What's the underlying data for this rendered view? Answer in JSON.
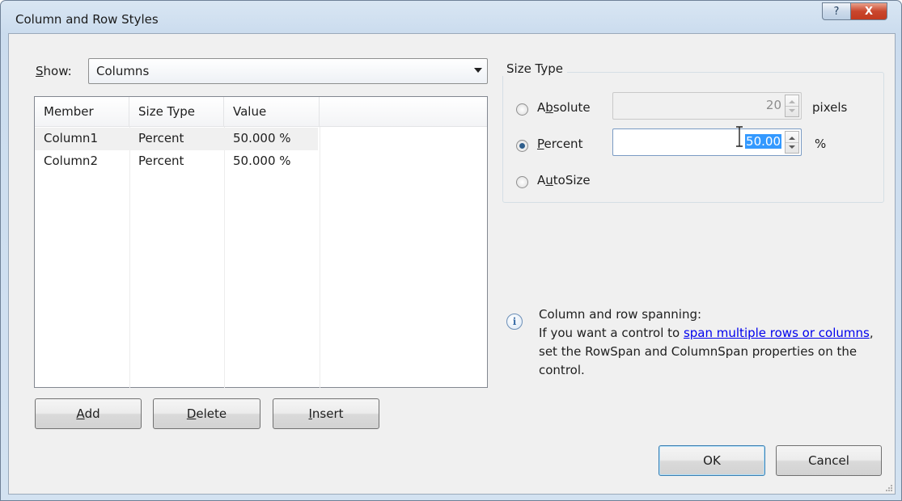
{
  "window": {
    "title": "Column and Row Styles",
    "help_glyph": "?",
    "close_glyph": "X"
  },
  "show": {
    "label_prefix": "S",
    "label_rest": "how:",
    "selected": "Columns"
  },
  "list": {
    "columns": [
      "Member",
      "Size Type",
      "Value"
    ],
    "rows": [
      {
        "member": "Column1",
        "size_type": "Percent",
        "value": "50.000 %"
      },
      {
        "member": "Column2",
        "size_type": "Percent",
        "value": "50.000 %"
      }
    ]
  },
  "buttons": {
    "add": {
      "mnemonic": "A",
      "rest": "dd"
    },
    "delete": {
      "mnemonic": "D",
      "rest": "elete"
    },
    "insert": {
      "mnemonic": "I",
      "rest": "nsert"
    },
    "ok": "OK",
    "cancel": "Cancel"
  },
  "size_type": {
    "title": "Size Type",
    "absolute": {
      "pre": "A",
      "mnemonic": "b",
      "rest": "solute",
      "value": "20",
      "unit": "pixels",
      "checked": false,
      "enabled": false
    },
    "percent": {
      "pre": "",
      "mnemonic": "P",
      "rest": "ercent",
      "value": "50.00",
      "unit": "%",
      "checked": true,
      "enabled": true
    },
    "autosize": {
      "pre": "A",
      "mnemonic": "u",
      "rest": "toSize",
      "checked": false
    }
  },
  "info": {
    "heading": "Column and row spanning:",
    "line_pre": "If you want a control to ",
    "link_text": "span multiple rows or columns",
    "line_post": ", set the RowSpan and ColumnSpan properties on the control.",
    "icon": "info-icon"
  },
  "colors": {
    "title_bar": "#cbdcee",
    "close_button": "#c9462d",
    "selection": "#3399ff",
    "link": "#0000ee"
  }
}
